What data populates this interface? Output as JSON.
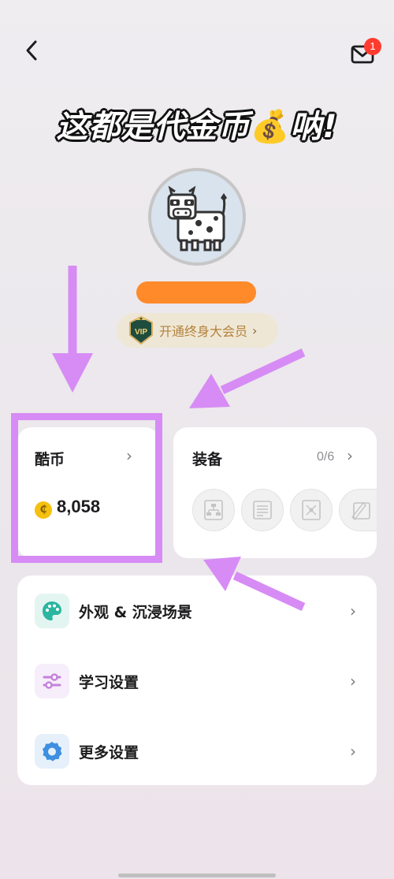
{
  "header": {
    "back_icon": "chevron-left-icon",
    "mail_icon": "mail-icon",
    "mail_badge": "1"
  },
  "caption": {
    "text_before": "这都是代金币",
    "emoji": "💰",
    "text_after": "呐!"
  },
  "profile": {
    "avatar_icon": "cow-avatar-icon",
    "name_bar_color": "#ff8a2a",
    "vip_label": "开通终身大会员",
    "vip_chevron": "›"
  },
  "coin_card": {
    "title": "酷币",
    "chevron": "›",
    "value": "8,058",
    "coin_symbol": "₵"
  },
  "equip_card": {
    "title": "装备",
    "count": "0/6",
    "chevron": "›",
    "slots": [
      "tree-diagram-icon",
      "document-icon",
      "mindmap-icon",
      "pencil-icon"
    ]
  },
  "menu": {
    "items": [
      {
        "label": "外观 & 沉浸场景",
        "icon": "palette-icon",
        "chevron": "›"
      },
      {
        "label": "学习设置",
        "icon": "sliders-icon",
        "chevron": "›"
      },
      {
        "label": "更多设置",
        "icon": "gear-icon",
        "chevron": "›"
      }
    ]
  },
  "colors": {
    "accent_purple": "#d68cf4",
    "vip_gold": "#b3823a",
    "coin_yellow": "#f5c10e",
    "badge_red": "#ff3b30"
  }
}
